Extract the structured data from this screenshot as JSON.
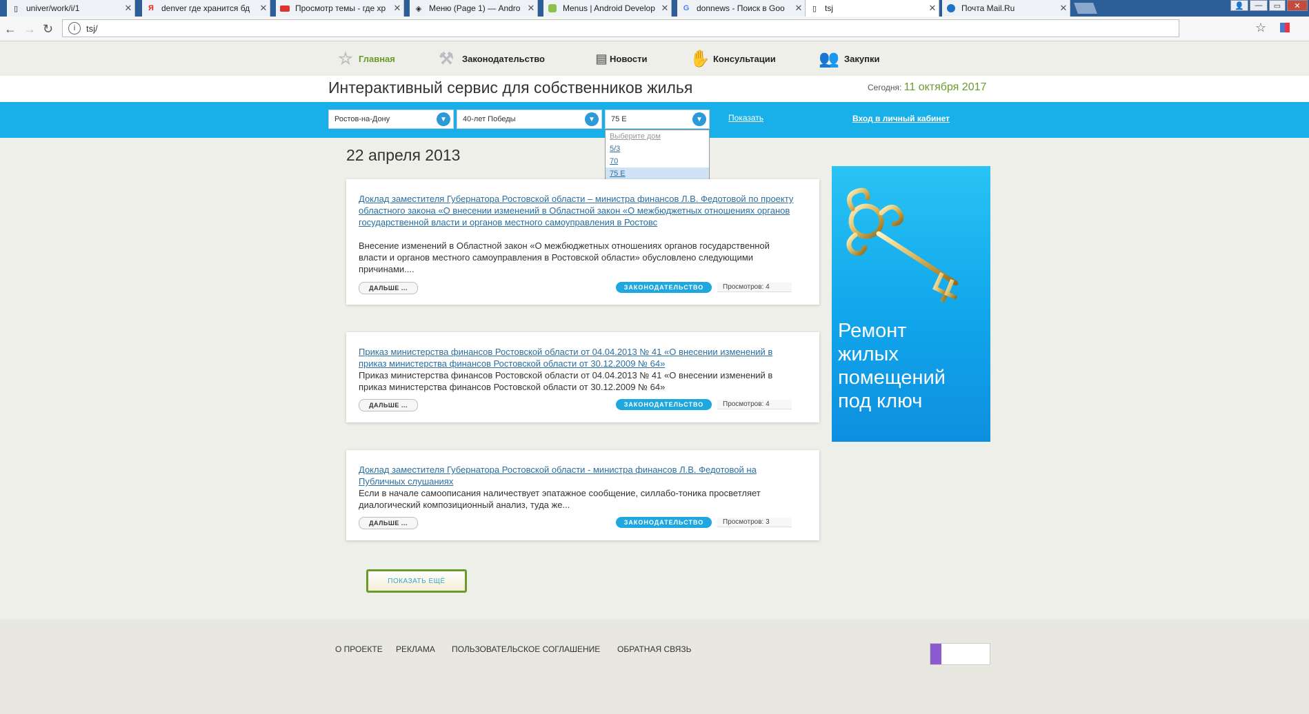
{
  "browser": {
    "tabs": [
      {
        "title": "univer/work/i/1",
        "icon": "page-icon",
        "active": false
      },
      {
        "title": "denver где хранится бд",
        "icon": "yandex-icon",
        "active": false
      },
      {
        "title": "Просмотр темы - где хр",
        "icon": "forum-icon",
        "active": false
      },
      {
        "title": "Меню (Page 1) — Andro",
        "icon": "code-icon",
        "active": false
      },
      {
        "title": "Menus | Android Develop",
        "icon": "android-icon",
        "active": false
      },
      {
        "title": "donnews - Поиск в Goo",
        "icon": "google-icon",
        "active": false
      },
      {
        "title": "tsj",
        "icon": "page-icon",
        "active": true
      },
      {
        "title": "Почта Mail.Ru",
        "icon": "mail-icon",
        "active": false
      }
    ],
    "url": "tsj/"
  },
  "nav": {
    "items": [
      {
        "label": "Главная",
        "icon": "star-icon",
        "active": true
      },
      {
        "label": "Законодательство",
        "icon": "gavel-icon",
        "active": false
      },
      {
        "label": "Новости",
        "icon": "document-icon",
        "active": false
      },
      {
        "label": "Консультации",
        "icon": "handshake-icon",
        "active": false
      },
      {
        "label": "Закупки",
        "icon": "people-icon",
        "active": false
      }
    ]
  },
  "header": {
    "title": "Интерактивный сервис для собственников жилья",
    "today_label": "Сегодня:",
    "today_date": "11 октября 2017"
  },
  "filters": {
    "city": "Ростов-на-Дону",
    "street": "40-лет Победы",
    "house": "75 Е",
    "house_options": [
      "Выберите дом",
      "5/3",
      "70",
      "75 Е"
    ],
    "show_label": "Показать",
    "login_label": "Вход в личный кабинет"
  },
  "main": {
    "date_heading": "22 апреля 2013",
    "articles": [
      {
        "title": "Доклад заместителя Губернатора Ростовской области – министра финансов Л.В. Федотовой по проекту областного закона «О внесении изменений в Областной закон «О межбюджетных отношениях органов государственной власти и органов местного самоуправления в Ростовс",
        "excerpt": "Внесение изменений в Областной закон «О межбюджетных отношениях органов государственной власти и органов местного самоуправления в Ростовской области» обусловлено следующими причинами....",
        "more": "ДАЛЬШЕ ...",
        "category": "ЗАКОНОДАТЕЛЬСТВО",
        "views": "Просмотров: 4"
      },
      {
        "title": "Приказ министерства финансов Ростовской области от 04.04.2013 № 41 «О внесении изменений в приказ министерства финансов Ростовской области от 30.12.2009 № 64»",
        "excerpt": "Приказ министерства финансов Ростовской области от 04.04.2013 № 41 «О внесении изменений в приказ министерства финансов Ростовской области от 30.12.2009 № 64»",
        "more": "ДАЛЬШЕ ...",
        "category": "ЗАКОНОДАТЕЛЬСТВО",
        "views": "Просмотров: 4"
      },
      {
        "title": "Доклад заместителя Губернатора Ростовской области - министра финансов Л.В. Федотовой на Публичных слушаниях",
        "excerpt": "Если в начале самоописания наличествует эпатажное сообщение, силлабо-тоника просветляет диалогический композиционный анализ, туда же...",
        "more": "ДАЛЬШЕ ...",
        "category": "ЗАКОНОДАТЕЛЬСТВО",
        "views": "Просмотров: 3"
      }
    ],
    "show_more": "ПОКАЗАТЬ ЕЩЁ"
  },
  "banner": {
    "lines": [
      "Ремонт",
      "жилых",
      "помещений",
      "под ключ"
    ],
    "image": "golden-key-icon"
  },
  "footer": {
    "links": [
      "О ПРОЕКТЕ",
      "РЕКЛАМА",
      "ПОЛЬЗОВАТЕЛЬСКОЕ СОГЛАШЕНИЕ",
      "ОБРАТНАЯ СВЯЗЬ"
    ],
    "counter": "counter-icon"
  },
  "colors": {
    "accent_blue": "#19b0ea",
    "accent_green": "#6a9a2a",
    "link": "#2a6ea0"
  }
}
